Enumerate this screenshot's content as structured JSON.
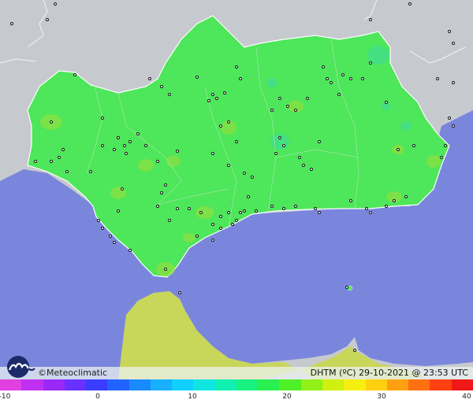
{
  "branding": {
    "name": "©Meteoclimatic",
    "logo_letter": "m"
  },
  "map_meta": {
    "variable_label": "DHTM (ºC)",
    "date": "29-10-2021",
    "time": "23:53 UTC",
    "stamp_text": "DHTM (ºC)   29-10-2021 @ 23:53 UTC"
  },
  "colors": {
    "sea": "#7a86dc",
    "foreign_land": "#c7cacf",
    "region_fill": "#4ee65a",
    "africa_fill": "#c8d65a",
    "border": "#ffffff"
  },
  "scale": {
    "min": -10,
    "max": 40,
    "tick_labels": [
      "-10",
      "0",
      "10",
      "20",
      "30",
      "40"
    ],
    "colors": [
      "#e040e0",
      "#c030f0",
      "#9a28f6",
      "#6a30ff",
      "#3a3cff",
      "#2262ff",
      "#1a8aff",
      "#18b0ff",
      "#10d0ff",
      "#10e6e0",
      "#10f0b0",
      "#18f280",
      "#28f050",
      "#50f028",
      "#90f018",
      "#d0f010",
      "#f6f010",
      "#ffd010",
      "#ffa010",
      "#ff7010",
      "#ff4010",
      "#f01818"
    ]
  },
  "stations": "dense"
}
